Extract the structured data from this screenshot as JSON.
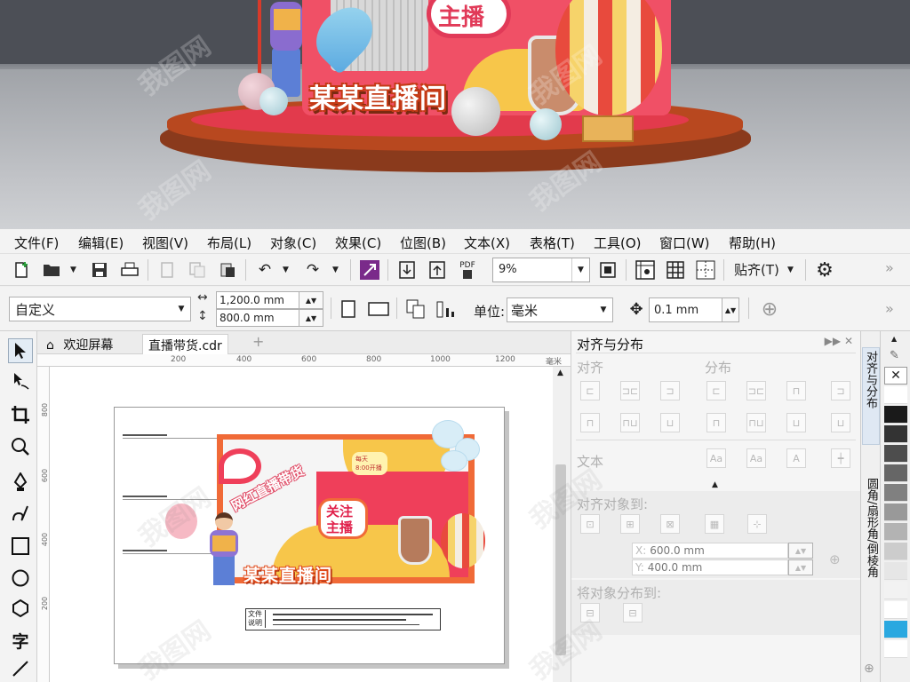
{
  "preview": {
    "title_3d": "某某直播间",
    "badge_3d": "主播",
    "colors": {
      "board": "#f05066",
      "stage_top": "#b8481f",
      "stage_base": "#8a3a1c"
    }
  },
  "menu": [
    "文件(F)",
    "编辑(E)",
    "视图(V)",
    "布局(L)",
    "对象(C)",
    "效果(C)",
    "位图(B)",
    "文本(X)",
    "表格(T)",
    "工具(O)",
    "窗口(W)",
    "帮助(H)"
  ],
  "toolbar": {
    "icons": [
      "new-document-icon",
      "open-folder-icon",
      "save-icon",
      "print-icon",
      "cut-icon",
      "copy-icon",
      "paste-icon",
      "undo-icon",
      "redo-icon",
      "corel-connect-icon",
      "import-icon",
      "export-icon",
      "publish-pdf-icon",
      "full-screen-icon",
      "show-rulers-icon",
      "show-grid-icon",
      "show-guidelines-icon",
      "options-gear-icon"
    ],
    "pdf_label": "PDF",
    "zoom": "9%",
    "snap_label": "贴齐(T)",
    "overflow": "»"
  },
  "property_bar": {
    "preset": "自定义",
    "width": "1,200.0 mm",
    "height": "800.0 mm",
    "unit_label": "单位:",
    "unit": "毫米",
    "nudge": "0.1 mm",
    "overflow": "»"
  },
  "tools": [
    "pick-tool-icon",
    "shape-tool-icon",
    "crop-tool-icon",
    "zoom-tool-icon",
    "pen-tool-icon",
    "freehand-tool-icon",
    "rectangle-tool-icon",
    "ellipse-tool-icon",
    "polygon-tool-icon",
    "text-tool-icon",
    "line-tool-icon"
  ],
  "text_tool_label": "字",
  "doc_tabs": [
    {
      "label": "欢迎屏幕"
    },
    {
      "label": "直播带货.cdr"
    }
  ],
  "ruler": {
    "h_ticks": [
      "200",
      "400",
      "600",
      "800",
      "1000",
      "1200"
    ],
    "unit": "毫米",
    "v_ticks": [
      "800",
      "600",
      "400",
      "200"
    ]
  },
  "artwork": {
    "title": "某某直播间",
    "ribbon": "网红直播带货",
    "tag_line1": "关注",
    "tag_line2": "主播",
    "time_line1": "每天",
    "time_line2": "8:00开播"
  },
  "legend": {
    "label_line1": "文件",
    "label_line2": "说明"
  },
  "docker": {
    "title": "对齐与分布",
    "controls": "▶▶ ✕",
    "align_label": "对齐",
    "distribute_label": "分布",
    "text_label": "文本",
    "align_to_label": "对齐对象到:",
    "x_label": "X:",
    "x_value": "600.0 mm",
    "y_label": "Y:",
    "y_value": "400.0 mm",
    "distribute_to_label": "将对象分布到:"
  },
  "side_tabs": [
    {
      "label": "对齐与分布"
    },
    {
      "label": "圆角/扇形角/倒棱角"
    }
  ],
  "palette": [
    "#ffffff",
    "#1a1a1a",
    "#333333",
    "#4d4d4d",
    "#666666",
    "#808080",
    "#999999",
    "#b3b3b3",
    "#cccccc",
    "#e6e6e6",
    "#f2f2f2",
    "#ffffff",
    "#2aa8e0",
    "#ffffff"
  ],
  "watermark": "我图网"
}
